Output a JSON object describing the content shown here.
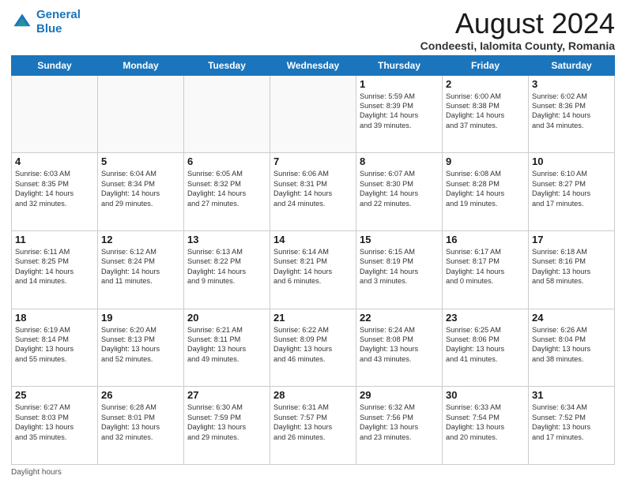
{
  "logo": {
    "line1": "General",
    "line2": "Blue"
  },
  "title": "August 2024",
  "subtitle": "Condeesti, Ialomita County, Romania",
  "days_of_week": [
    "Sunday",
    "Monday",
    "Tuesday",
    "Wednesday",
    "Thursday",
    "Friday",
    "Saturday"
  ],
  "footer": "Daylight hours",
  "weeks": [
    [
      {
        "day": "",
        "info": ""
      },
      {
        "day": "",
        "info": ""
      },
      {
        "day": "",
        "info": ""
      },
      {
        "day": "",
        "info": ""
      },
      {
        "day": "1",
        "info": "Sunrise: 5:59 AM\nSunset: 8:39 PM\nDaylight: 14 hours\nand 39 minutes."
      },
      {
        "day": "2",
        "info": "Sunrise: 6:00 AM\nSunset: 8:38 PM\nDaylight: 14 hours\nand 37 minutes."
      },
      {
        "day": "3",
        "info": "Sunrise: 6:02 AM\nSunset: 8:36 PM\nDaylight: 14 hours\nand 34 minutes."
      }
    ],
    [
      {
        "day": "4",
        "info": "Sunrise: 6:03 AM\nSunset: 8:35 PM\nDaylight: 14 hours\nand 32 minutes."
      },
      {
        "day": "5",
        "info": "Sunrise: 6:04 AM\nSunset: 8:34 PM\nDaylight: 14 hours\nand 29 minutes."
      },
      {
        "day": "6",
        "info": "Sunrise: 6:05 AM\nSunset: 8:32 PM\nDaylight: 14 hours\nand 27 minutes."
      },
      {
        "day": "7",
        "info": "Sunrise: 6:06 AM\nSunset: 8:31 PM\nDaylight: 14 hours\nand 24 minutes."
      },
      {
        "day": "8",
        "info": "Sunrise: 6:07 AM\nSunset: 8:30 PM\nDaylight: 14 hours\nand 22 minutes."
      },
      {
        "day": "9",
        "info": "Sunrise: 6:08 AM\nSunset: 8:28 PM\nDaylight: 14 hours\nand 19 minutes."
      },
      {
        "day": "10",
        "info": "Sunrise: 6:10 AM\nSunset: 8:27 PM\nDaylight: 14 hours\nand 17 minutes."
      }
    ],
    [
      {
        "day": "11",
        "info": "Sunrise: 6:11 AM\nSunset: 8:25 PM\nDaylight: 14 hours\nand 14 minutes."
      },
      {
        "day": "12",
        "info": "Sunrise: 6:12 AM\nSunset: 8:24 PM\nDaylight: 14 hours\nand 11 minutes."
      },
      {
        "day": "13",
        "info": "Sunrise: 6:13 AM\nSunset: 8:22 PM\nDaylight: 14 hours\nand 9 minutes."
      },
      {
        "day": "14",
        "info": "Sunrise: 6:14 AM\nSunset: 8:21 PM\nDaylight: 14 hours\nand 6 minutes."
      },
      {
        "day": "15",
        "info": "Sunrise: 6:15 AM\nSunset: 8:19 PM\nDaylight: 14 hours\nand 3 minutes."
      },
      {
        "day": "16",
        "info": "Sunrise: 6:17 AM\nSunset: 8:17 PM\nDaylight: 14 hours\nand 0 minutes."
      },
      {
        "day": "17",
        "info": "Sunrise: 6:18 AM\nSunset: 8:16 PM\nDaylight: 13 hours\nand 58 minutes."
      }
    ],
    [
      {
        "day": "18",
        "info": "Sunrise: 6:19 AM\nSunset: 8:14 PM\nDaylight: 13 hours\nand 55 minutes."
      },
      {
        "day": "19",
        "info": "Sunrise: 6:20 AM\nSunset: 8:13 PM\nDaylight: 13 hours\nand 52 minutes."
      },
      {
        "day": "20",
        "info": "Sunrise: 6:21 AM\nSunset: 8:11 PM\nDaylight: 13 hours\nand 49 minutes."
      },
      {
        "day": "21",
        "info": "Sunrise: 6:22 AM\nSunset: 8:09 PM\nDaylight: 13 hours\nand 46 minutes."
      },
      {
        "day": "22",
        "info": "Sunrise: 6:24 AM\nSunset: 8:08 PM\nDaylight: 13 hours\nand 43 minutes."
      },
      {
        "day": "23",
        "info": "Sunrise: 6:25 AM\nSunset: 8:06 PM\nDaylight: 13 hours\nand 41 minutes."
      },
      {
        "day": "24",
        "info": "Sunrise: 6:26 AM\nSunset: 8:04 PM\nDaylight: 13 hours\nand 38 minutes."
      }
    ],
    [
      {
        "day": "25",
        "info": "Sunrise: 6:27 AM\nSunset: 8:03 PM\nDaylight: 13 hours\nand 35 minutes."
      },
      {
        "day": "26",
        "info": "Sunrise: 6:28 AM\nSunset: 8:01 PM\nDaylight: 13 hours\nand 32 minutes."
      },
      {
        "day": "27",
        "info": "Sunrise: 6:30 AM\nSunset: 7:59 PM\nDaylight: 13 hours\nand 29 minutes."
      },
      {
        "day": "28",
        "info": "Sunrise: 6:31 AM\nSunset: 7:57 PM\nDaylight: 13 hours\nand 26 minutes."
      },
      {
        "day": "29",
        "info": "Sunrise: 6:32 AM\nSunset: 7:56 PM\nDaylight: 13 hours\nand 23 minutes."
      },
      {
        "day": "30",
        "info": "Sunrise: 6:33 AM\nSunset: 7:54 PM\nDaylight: 13 hours\nand 20 minutes."
      },
      {
        "day": "31",
        "info": "Sunrise: 6:34 AM\nSunset: 7:52 PM\nDaylight: 13 hours\nand 17 minutes."
      }
    ]
  ]
}
